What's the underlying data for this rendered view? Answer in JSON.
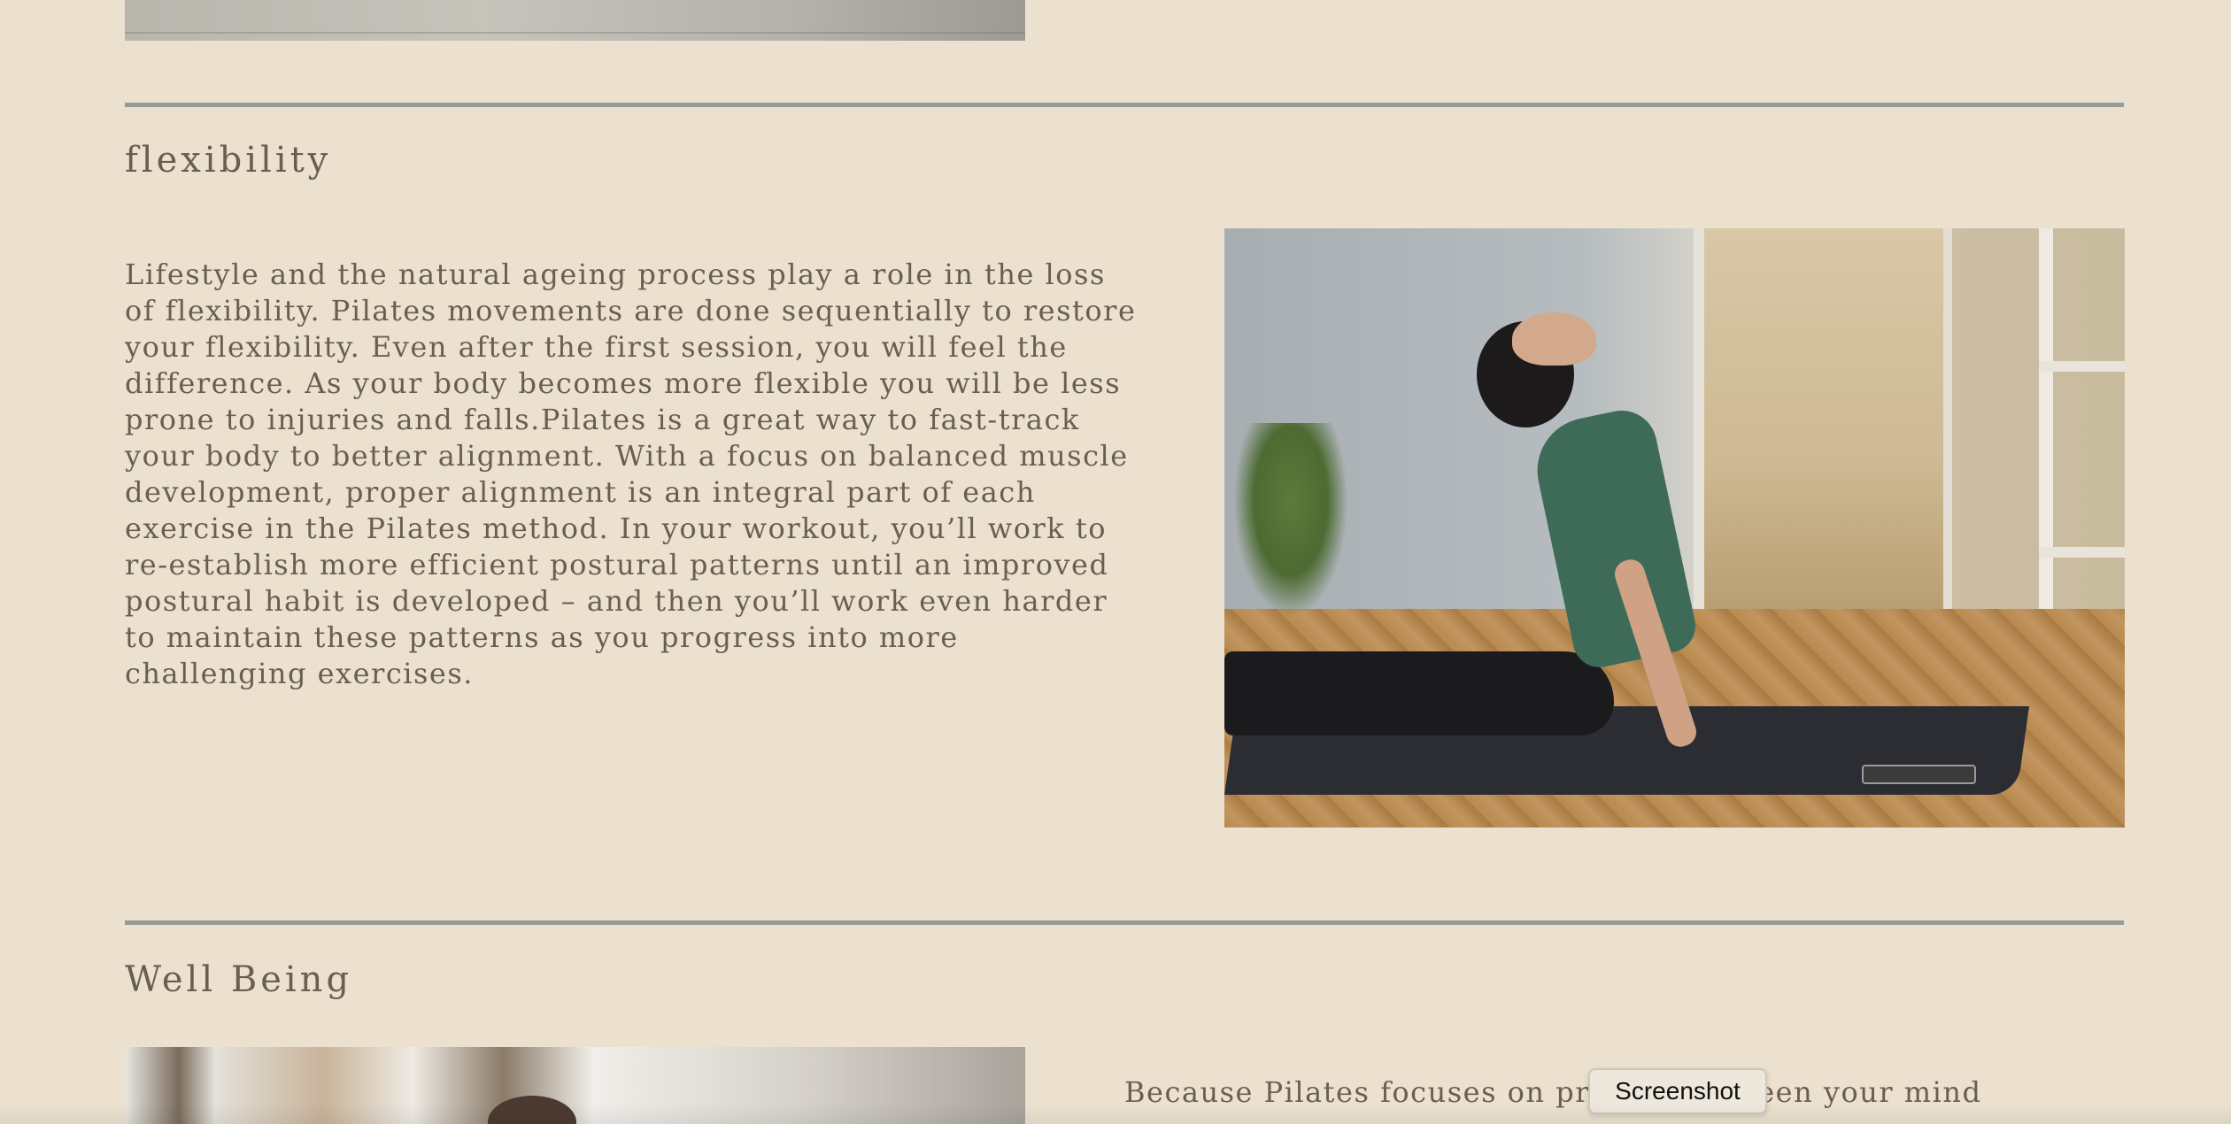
{
  "sections": {
    "flexibility": {
      "title": "flexibility",
      "body": "Lifestyle and the natural ageing process play a role in the loss of flexibility. Pilates movements are done sequentially to restore your flexibility. Even after the first session, you will feel the difference. As your body becomes more flexible you will be less prone to injuries and falls.Pilates is a great way to fast-track your body to better alignment. With a focus on balanced muscle development, proper alignment is an integral part of each exercise in the Pilates method. In your workout, you’ll work to re-establish more efficient postural patterns until an improved postural habit is developed – and then you’ll work even harder to maintain these patterns as you progress into more challenging exercises."
    },
    "well_being": {
      "title": "Well Being",
      "body_visible": "Because Pilates focuses on prov          ce between your mind"
    }
  },
  "tooltip": {
    "label": "Screenshot"
  },
  "colors": {
    "background": "#ece1cf",
    "text": "#6a5e52",
    "divider": "#959b96"
  }
}
